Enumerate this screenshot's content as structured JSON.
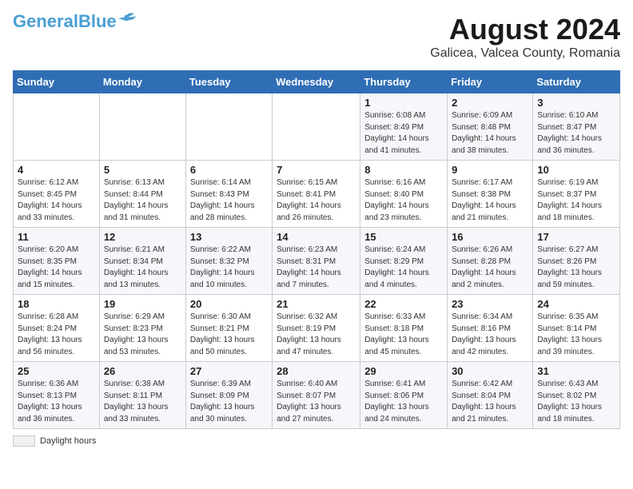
{
  "header": {
    "logo_line1": "General",
    "logo_line2": "Blue",
    "month_year": "August 2024",
    "location": "Galicea, Valcea County, Romania"
  },
  "weekdays": [
    "Sunday",
    "Monday",
    "Tuesday",
    "Wednesday",
    "Thursday",
    "Friday",
    "Saturday"
  ],
  "weeks": [
    [
      {
        "day": "",
        "info": ""
      },
      {
        "day": "",
        "info": ""
      },
      {
        "day": "",
        "info": ""
      },
      {
        "day": "",
        "info": ""
      },
      {
        "day": "1",
        "info": "Sunrise: 6:08 AM\nSunset: 8:49 PM\nDaylight: 14 hours and 41 minutes."
      },
      {
        "day": "2",
        "info": "Sunrise: 6:09 AM\nSunset: 8:48 PM\nDaylight: 14 hours and 38 minutes."
      },
      {
        "day": "3",
        "info": "Sunrise: 6:10 AM\nSunset: 8:47 PM\nDaylight: 14 hours and 36 minutes."
      }
    ],
    [
      {
        "day": "4",
        "info": "Sunrise: 6:12 AM\nSunset: 8:45 PM\nDaylight: 14 hours and 33 minutes."
      },
      {
        "day": "5",
        "info": "Sunrise: 6:13 AM\nSunset: 8:44 PM\nDaylight: 14 hours and 31 minutes."
      },
      {
        "day": "6",
        "info": "Sunrise: 6:14 AM\nSunset: 8:43 PM\nDaylight: 14 hours and 28 minutes."
      },
      {
        "day": "7",
        "info": "Sunrise: 6:15 AM\nSunset: 8:41 PM\nDaylight: 14 hours and 26 minutes."
      },
      {
        "day": "8",
        "info": "Sunrise: 6:16 AM\nSunset: 8:40 PM\nDaylight: 14 hours and 23 minutes."
      },
      {
        "day": "9",
        "info": "Sunrise: 6:17 AM\nSunset: 8:38 PM\nDaylight: 14 hours and 21 minutes."
      },
      {
        "day": "10",
        "info": "Sunrise: 6:19 AM\nSunset: 8:37 PM\nDaylight: 14 hours and 18 minutes."
      }
    ],
    [
      {
        "day": "11",
        "info": "Sunrise: 6:20 AM\nSunset: 8:35 PM\nDaylight: 14 hours and 15 minutes."
      },
      {
        "day": "12",
        "info": "Sunrise: 6:21 AM\nSunset: 8:34 PM\nDaylight: 14 hours and 13 minutes."
      },
      {
        "day": "13",
        "info": "Sunrise: 6:22 AM\nSunset: 8:32 PM\nDaylight: 14 hours and 10 minutes."
      },
      {
        "day": "14",
        "info": "Sunrise: 6:23 AM\nSunset: 8:31 PM\nDaylight: 14 hours and 7 minutes."
      },
      {
        "day": "15",
        "info": "Sunrise: 6:24 AM\nSunset: 8:29 PM\nDaylight: 14 hours and 4 minutes."
      },
      {
        "day": "16",
        "info": "Sunrise: 6:26 AM\nSunset: 8:28 PM\nDaylight: 14 hours and 2 minutes."
      },
      {
        "day": "17",
        "info": "Sunrise: 6:27 AM\nSunset: 8:26 PM\nDaylight: 13 hours and 59 minutes."
      }
    ],
    [
      {
        "day": "18",
        "info": "Sunrise: 6:28 AM\nSunset: 8:24 PM\nDaylight: 13 hours and 56 minutes."
      },
      {
        "day": "19",
        "info": "Sunrise: 6:29 AM\nSunset: 8:23 PM\nDaylight: 13 hours and 53 minutes."
      },
      {
        "day": "20",
        "info": "Sunrise: 6:30 AM\nSunset: 8:21 PM\nDaylight: 13 hours and 50 minutes."
      },
      {
        "day": "21",
        "info": "Sunrise: 6:32 AM\nSunset: 8:19 PM\nDaylight: 13 hours and 47 minutes."
      },
      {
        "day": "22",
        "info": "Sunrise: 6:33 AM\nSunset: 8:18 PM\nDaylight: 13 hours and 45 minutes."
      },
      {
        "day": "23",
        "info": "Sunrise: 6:34 AM\nSunset: 8:16 PM\nDaylight: 13 hours and 42 minutes."
      },
      {
        "day": "24",
        "info": "Sunrise: 6:35 AM\nSunset: 8:14 PM\nDaylight: 13 hours and 39 minutes."
      }
    ],
    [
      {
        "day": "25",
        "info": "Sunrise: 6:36 AM\nSunset: 8:13 PM\nDaylight: 13 hours and 36 minutes."
      },
      {
        "day": "26",
        "info": "Sunrise: 6:38 AM\nSunset: 8:11 PM\nDaylight: 13 hours and 33 minutes."
      },
      {
        "day": "27",
        "info": "Sunrise: 6:39 AM\nSunset: 8:09 PM\nDaylight: 13 hours and 30 minutes."
      },
      {
        "day": "28",
        "info": "Sunrise: 6:40 AM\nSunset: 8:07 PM\nDaylight: 13 hours and 27 minutes."
      },
      {
        "day": "29",
        "info": "Sunrise: 6:41 AM\nSunset: 8:06 PM\nDaylight: 13 hours and 24 minutes."
      },
      {
        "day": "30",
        "info": "Sunrise: 6:42 AM\nSunset: 8:04 PM\nDaylight: 13 hours and 21 minutes."
      },
      {
        "day": "31",
        "info": "Sunrise: 6:43 AM\nSunset: 8:02 PM\nDaylight: 13 hours and 18 minutes."
      }
    ]
  ],
  "legend": {
    "label": "Daylight hours"
  }
}
